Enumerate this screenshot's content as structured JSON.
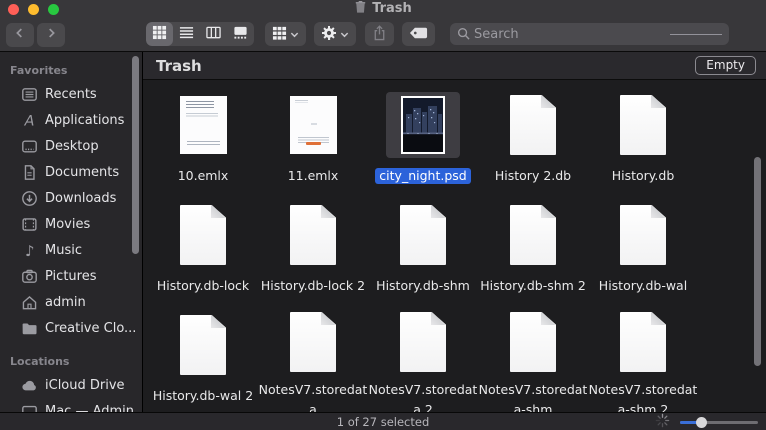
{
  "window": {
    "title": "Trash"
  },
  "titlebar": {
    "icons": [
      "close-button",
      "minimize-button",
      "zoom-button",
      "trash-icon"
    ]
  },
  "toolbar": {
    "search": {
      "placeholder": "Search"
    },
    "selected_view": "icon",
    "icons": [
      "back-icon",
      "forward-icon",
      "icon-view-icon",
      "list-view-icon",
      "column-view-icon",
      "gallery-view-icon",
      "group-icon",
      "chevron-down-icon",
      "gear-icon",
      "share-icon",
      "tag-icon",
      "search-icon"
    ]
  },
  "sidebar": {
    "sections": [
      {
        "title": "Favorites",
        "items": [
          {
            "id": "recents",
            "label": "Recents",
            "icon": "recents-icon"
          },
          {
            "id": "applications",
            "label": "Applications",
            "icon": "applications-icon"
          },
          {
            "id": "desktop",
            "label": "Desktop",
            "icon": "desktop-icon"
          },
          {
            "id": "documents",
            "label": "Documents",
            "icon": "documents-icon"
          },
          {
            "id": "downloads",
            "label": "Downloads",
            "icon": "downloads-icon"
          },
          {
            "id": "movies",
            "label": "Movies",
            "icon": "movies-icon"
          },
          {
            "id": "music",
            "label": "Music",
            "icon": "music-icon"
          },
          {
            "id": "pictures",
            "label": "Pictures",
            "icon": "pictures-icon"
          },
          {
            "id": "admin",
            "label": "admin",
            "icon": "home-icon"
          },
          {
            "id": "creative-cloud",
            "label": "Creative Clo...",
            "icon": "folder-icon"
          }
        ]
      },
      {
        "title": "Locations",
        "items": [
          {
            "id": "icloud-drive",
            "label": "iCloud Drive",
            "icon": "cloud-icon"
          },
          {
            "id": "mac-admin",
            "label": "Mac — Admin",
            "icon": "display-icon"
          }
        ]
      }
    ]
  },
  "content": {
    "header": {
      "title": "Trash",
      "empty_button": "Empty"
    },
    "files": [
      {
        "name": "10.emlx",
        "icon": "email-thumbnail",
        "selected": false
      },
      {
        "name": "11.emlx",
        "icon": "email-thumbnail-2",
        "selected": false
      },
      {
        "name": "city_night.psd",
        "icon": "image-thumbnail",
        "selected": true
      },
      {
        "name": "History 2.db",
        "icon": "generic-document",
        "selected": false
      },
      {
        "name": "History.db",
        "icon": "generic-document",
        "selected": false
      },
      {
        "name": "History.db-lock",
        "icon": "generic-document",
        "selected": false
      },
      {
        "name": "History.db-lock 2",
        "icon": "generic-document",
        "selected": false
      },
      {
        "name": "History.db-shm",
        "icon": "generic-document",
        "selected": false
      },
      {
        "name": "History.db-shm 2",
        "icon": "generic-document",
        "selected": false
      },
      {
        "name": "History.db-wal",
        "icon": "generic-document",
        "selected": false
      },
      {
        "name": "History.db-wal 2",
        "icon": "generic-document",
        "selected": false
      },
      {
        "name": "NotesV7.storedata",
        "icon": "generic-document",
        "selected": false
      },
      {
        "name": "NotesV7.storedata 2",
        "icon": "generic-document",
        "selected": false
      },
      {
        "name": "NotesV7.storedata-shm",
        "icon": "generic-document",
        "selected": false
      },
      {
        "name": "NotesV7.storedata-shm 2",
        "icon": "generic-document",
        "selected": false
      }
    ]
  },
  "statusbar": {
    "text": "1 of 27 selected",
    "zoom_slider_percent": 25,
    "icons": [
      "spinner-icon"
    ]
  },
  "colors": {
    "selection_blue": "#2c63da",
    "traffic_red": "#ff5f57",
    "traffic_yellow": "#febc2e",
    "traffic_green": "#28c840"
  }
}
